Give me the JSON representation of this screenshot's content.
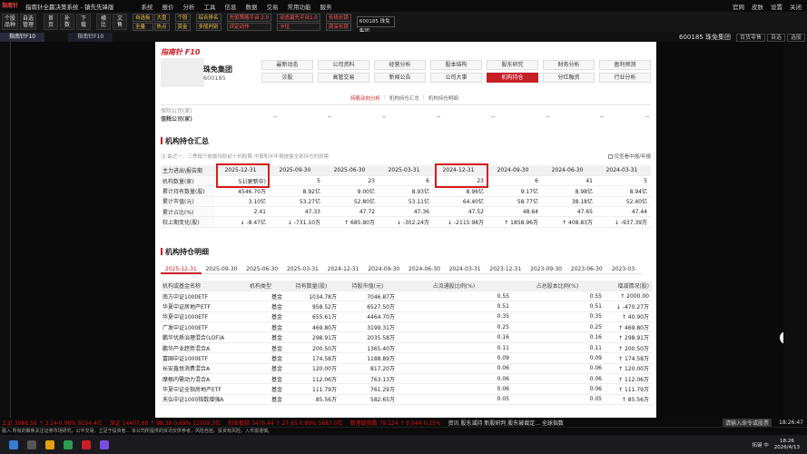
{
  "titlebar": {
    "logo": "指南针",
    "title": "指南针全赢决策系统 - 镇先先锋版",
    "menu": [
      "系统",
      "报价",
      "分析",
      "工具",
      "信息",
      "数据",
      "交易",
      "常用功能",
      "服务"
    ],
    "right": [
      "官网",
      "皮肤",
      "设置",
      "关闭"
    ]
  },
  "toolbar": {
    "buttons": [
      "个股品种",
      "自选管理",
      "首页",
      "补数",
      "下载",
      "横比",
      "文售"
    ],
    "grid1": [
      "自选板",
      "大盘",
      "全量",
      "热点"
    ],
    "grid2": [
      "个股",
      "资金",
      "多般"
    ],
    "grid3": [
      "综合排名",
      "多般判别"
    ],
    "grid4": [
      "先驱策略平台 2.0",
      "评定动作"
    ],
    "grid5": [
      "动态最先平台1.0",
      "卡位"
    ],
    "grid6": [
      "长线长锁",
      "资深长锁"
    ],
    "code_box": "600185 珠免集团"
  },
  "tabs": {
    "items": [
      "指南针F10",
      "指南针F10"
    ],
    "code": "600185 珠免集团",
    "right": [
      "百货零售",
      "自选",
      "选股"
    ]
  },
  "header": {
    "brand": "指南针 F10",
    "stock_name": "珠免集团",
    "stock_code": "600185",
    "nav": [
      "最新动态",
      "公司资料",
      "经营分析",
      "股本结构",
      "股东研究",
      "财务分析",
      "盈利预测",
      "诊股",
      "高管交易",
      "新闻公告",
      "公司大事",
      "机构持仓",
      "分红融资",
      "行业分析"
    ],
    "subnav": [
      "持股动向分析",
      "机构持仓汇总",
      "机构持仓明细"
    ]
  },
  "top_rows": [
    {
      "label": "保险公司(家)",
      "values": [
        "--",
        "--",
        "--",
        "--",
        "--",
        "--",
        "--",
        "--"
      ]
    },
    {
      "label": "信托公司(家)",
      "values": [
        "--",
        "--",
        "--",
        "--",
        "--",
        "--",
        "--",
        "--"
      ]
    }
  ],
  "summary": {
    "title": "机构持仓汇总",
    "note": "注:最近一、三季报只披露持股前十的股票,中报和半年报披露全部持仓的股票",
    "checkbox": "仅查看中报/年报",
    "header": [
      "主力进出\\报告期",
      "2025-12-31",
      "2025-09-30",
      "2025-06-30",
      "2025-03-31",
      "2024-12-31",
      "2024-09-30",
      "2024-06-30",
      "2024-03-31"
    ],
    "rows": [
      {
        "label": "机构数量(家)",
        "values": [
          "51(更新中)",
          "5",
          "23",
          "6",
          "23",
          "6",
          "41",
          "5"
        ]
      },
      {
        "label": "累计持有数量(股)",
        "values": [
          "4546.70万",
          "8.92亿",
          "9.00亿",
          "8.93亿",
          "8.96亿",
          "9.17亿",
          "8.98亿",
          "8.94亿"
        ]
      },
      {
        "label": "累计市值(元)",
        "values": [
          "3.10亿",
          "53.27亿",
          "52.80亿",
          "53.11亿",
          "64.40亿",
          "58.77亿",
          "38.18亿",
          "52.40亿"
        ]
      },
      {
        "label": "累计占比(%)",
        "values": [
          "2.41",
          "47.33",
          "47.72",
          "47.36",
          "47.52",
          "48.64",
          "47.65",
          "47.44"
        ]
      },
      {
        "label": "较上期变化(股)",
        "values": [
          "↓ -8.47亿",
          "↓ -731.10万",
          "↑ 685.80万",
          "↓ -302.24万",
          "↓ -2115.98万",
          "↑ 1858.96万",
          "↑ 408.83万",
          "↓ -937.39万"
        ]
      }
    ]
  },
  "detail": {
    "title": "机构持仓明细",
    "dates": [
      "2025-12-31",
      "2025-09-30",
      "2025-06-30",
      "2025-03-31",
      "2024-12-31",
      "2024-09-30",
      "2024-06-30",
      "2024-03-31",
      "2023-12-31",
      "2023-09-30",
      "2023-06-30",
      "2023-03-"
    ],
    "header": [
      "机构或基金名称",
      "机构类型",
      "持有数量(股)",
      "持股市值(元)",
      "占流通股比例(%)",
      "占总股本比例(%)",
      "增减情况(股)"
    ],
    "rows": [
      [
        "南方中证1000ETF",
        "基金",
        "1034.78万",
        "7046.87万",
        "0.55",
        "0.55",
        "↑ 2000.00"
      ],
      [
        "华夏中证房地产ETF",
        "基金",
        "958.52万",
        "6527.50万",
        "0.51",
        "0.51",
        "↓ -470.27万"
      ],
      [
        "华夏中证1000ETF",
        "基金",
        "655.61万",
        "4464.70万",
        "0.35",
        "0.35",
        "↑ 40.90万"
      ],
      [
        "广发中证1000ETF",
        "基金",
        "469.80万",
        "3199.31万",
        "0.25",
        "0.25",
        "↑ 469.80万"
      ],
      [
        "鹏华优质治理混合(LOF)A",
        "基金",
        "298.91万",
        "2035.58万",
        "0.16",
        "0.16",
        "↑ 298.91万"
      ],
      [
        "鹏华产业趋势混合A",
        "基金",
        "200.50万",
        "1365.40万",
        "0.11",
        "0.11",
        "↑ 200.50万"
      ],
      [
        "富国中证1000ETF",
        "基金",
        "174.58万",
        "1188.89万",
        "0.09",
        "0.09",
        "↑ 174.58万"
      ],
      [
        "长安鑫悦消费混合A",
        "基金",
        "120.00万",
        "817.20万",
        "0.06",
        "0.06",
        "↑ 120.00万"
      ],
      [
        "摩根内需动力混合A",
        "基金",
        "112.06万",
        "763.13万",
        "0.06",
        "0.06",
        "↑ 112.06万"
      ],
      [
        "华夏中证全指房地产ETF",
        "基金",
        "111.79万",
        "761.29万",
        "0.06",
        "0.06",
        "↑ 111.79万"
      ],
      [
        "天弘中证1000指数增强A",
        "基金",
        "85.56万",
        "582.65万",
        "0.05",
        "0.05",
        "↑ 85.56万"
      ]
    ]
  },
  "statusbar": {
    "items": [
      "上证 3988.56 ↑ 3.24 0.08% 9194.4亿",
      "深证 14407.86 ↑ 98.39 0.69% 12309.3亿",
      "创业板指 3476.44 ↑ 27.65 0.80% 5687.0亿",
      "新港跃指数 79.124 ↑ 0.044 0.15%",
      "资讯 股东减持 新股研判 股东被裁定... 全球指数"
    ],
    "search": "请输入命令或股票",
    "time": "18:26:47",
    "ticker": "融入·所有的聚焦关注证券市场研究，公平交易，立足于投资者... 本公司所提供的资讯仅供参考，风险自担。投资有风险，入市需谨慎。",
    "clock_time": "18:26",
    "clock_date": "2026/4/13",
    "tray": "拓键 中"
  },
  "colors": {
    "accent": "#c71f26",
    "up": "#d11",
    "down": "#0a8a2a",
    "highlight": "#d61c1c"
  }
}
